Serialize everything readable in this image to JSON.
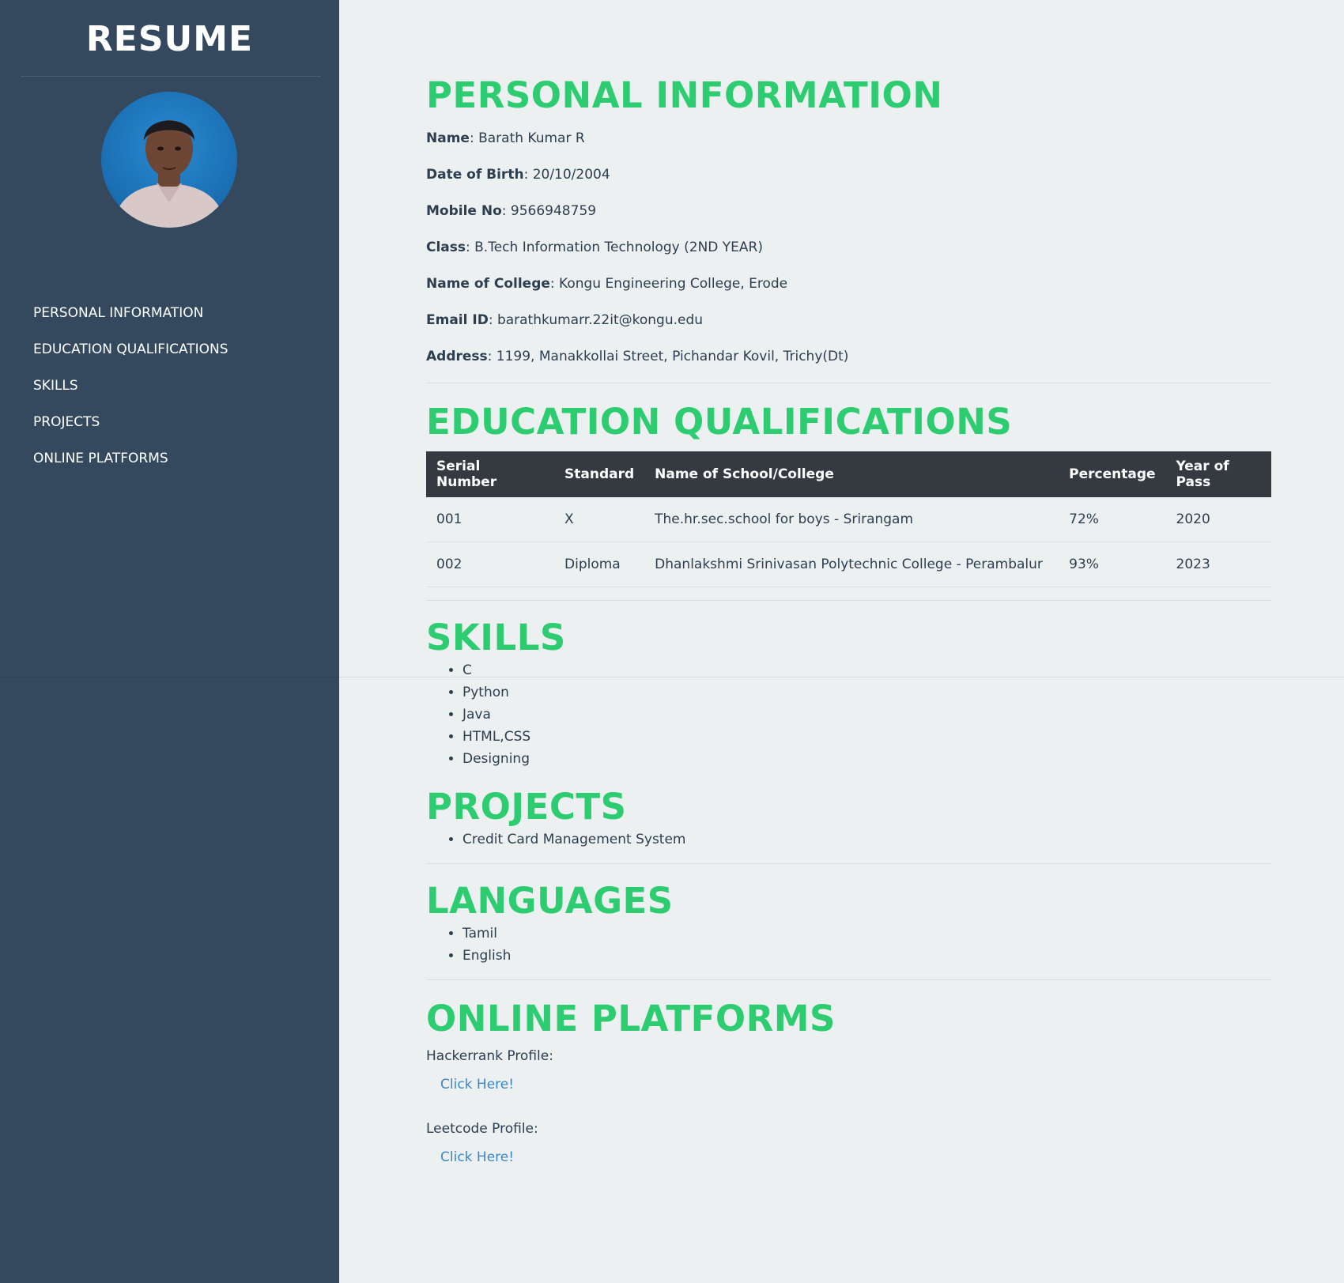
{
  "sidebar": {
    "brand": "RESUME",
    "nav": [
      "PERSONAL INFORMATION",
      "EDUCATION QUALIFICATIONS",
      "SKILLS",
      "PROJECTS",
      "ONLINE PLATFORMS"
    ]
  },
  "personal": {
    "title": "PERSONAL INFORMATION",
    "fields": [
      {
        "label": "Name",
        "value": ": Barath Kumar R"
      },
      {
        "label": "Date of Birth",
        "value": ": 20/10/2004"
      },
      {
        "label": "Mobile No",
        "value": ": 9566948759"
      },
      {
        "label": "Class",
        "value": ": B.Tech Information Technology (2ND YEAR)"
      },
      {
        "label": "Name of College",
        "value": ": Kongu Engineering College, Erode"
      },
      {
        "label": "Email ID",
        "value": ": barathkumarr.22it@kongu.edu"
      },
      {
        "label": "Address",
        "value": ": 1199, Manakkollai Street, Pichandar Kovil, Trichy(Dt)"
      }
    ]
  },
  "education": {
    "title": "EDUCATION QUALIFICATIONS",
    "headers": [
      "Serial Number",
      "Standard",
      "Name of School/College",
      "Percentage",
      "Year of Pass"
    ],
    "rows": [
      [
        "001",
        "X",
        "The.hr.sec.school for boys - Srirangam",
        "72%",
        "2020"
      ],
      [
        "002",
        "Diploma",
        "Dhanlakshmi Srinivasan Polytechnic College - Perambalur",
        "93%",
        "2023"
      ]
    ]
  },
  "skills": {
    "title": "SKILLS",
    "items": [
      "C",
      "Python",
      "Java",
      "HTML,CSS",
      "Designing"
    ]
  },
  "projects": {
    "title": "PROJECTS",
    "items": [
      "Credit Card Management System"
    ]
  },
  "languages": {
    "title": "LANGUAGES",
    "items": [
      "Tamil",
      "English"
    ]
  },
  "platforms": {
    "title": "ONLINE PLATFORMS",
    "items": [
      {
        "label": "Hackerrank Profile:",
        "link": "Click Here!"
      },
      {
        "label": "Leetcode Profile:",
        "link": "Click Here!"
      }
    ]
  },
  "colors": {
    "sidebar_bg": "#34495e",
    "main_bg": "#ecf0f1",
    "heading_green": "#2ecc71",
    "table_header_bg": "#343a40",
    "link_blue": "#3a87c8"
  }
}
